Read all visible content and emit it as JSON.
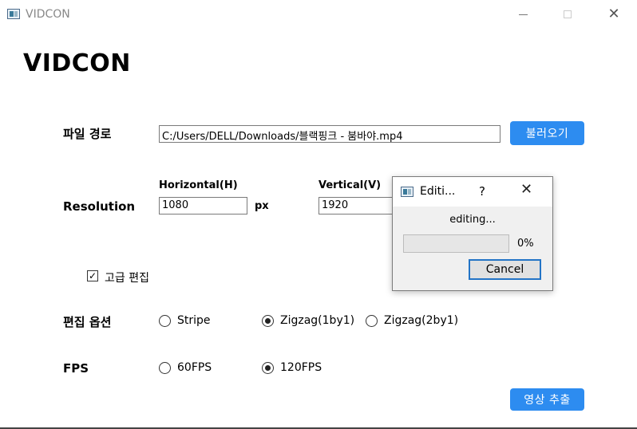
{
  "window": {
    "title": "VIDCON"
  },
  "app_title": "VIDCON",
  "file_path": {
    "label": "파일 경로",
    "value": "C:/Users/DELL/Downloads/블랙핑크 - 붐바야.mp4",
    "load_button": "불러오기"
  },
  "resolution": {
    "label": "Resolution",
    "horizontal_label": "Horizontal(H)",
    "horizontal_value": "1080",
    "unit": "px",
    "vertical_label": "Vertical(V)",
    "vertical_value": "1920"
  },
  "advanced_edit": {
    "label": "고급 편집",
    "checked": true,
    "check_glyph": "✓"
  },
  "edit_options": {
    "label": "편집 옵션",
    "options": [
      {
        "label": "Stripe",
        "selected": false
      },
      {
        "label": "Zigzag(1by1)",
        "selected": true
      },
      {
        "label": "Zigzag(2by1)",
        "selected": false
      }
    ]
  },
  "fps": {
    "label": "FPS",
    "options": [
      {
        "label": "60FPS",
        "selected": false
      },
      {
        "label": "120FPS",
        "selected": true
      }
    ]
  },
  "extract_button": "영상 추출",
  "dialog": {
    "title": "Editi...",
    "help": "?",
    "close": "✕",
    "message": "editing...",
    "progress": 0,
    "percent_label": "0%",
    "cancel_button": "Cancel"
  },
  "colors": {
    "accent": "#2d8cf0",
    "progress_fill": "#06b025",
    "dialog_bg": "#f0f0f0"
  },
  "icons": {
    "app": "app-window-icon",
    "minimize": "minimize-icon",
    "maximize": "maximize-icon",
    "close": "close-icon"
  }
}
